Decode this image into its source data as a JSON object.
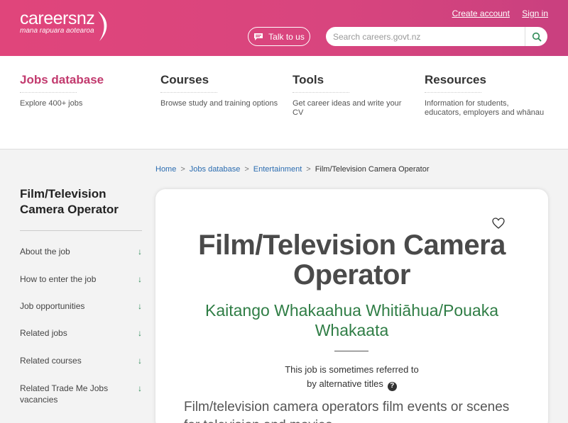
{
  "header": {
    "logo_main": "careersnz",
    "logo_sub": "mana rapuara aotearoa",
    "create_account": "Create account",
    "sign_in": "Sign in",
    "talk_label": "Talk to us",
    "search_placeholder": "Search careers.govt.nz",
    "brand_color": "#d8457e"
  },
  "nav": [
    {
      "title": "Jobs database",
      "desc": "Explore 400+ jobs"
    },
    {
      "title": "Courses",
      "desc": "Browse study and training options"
    },
    {
      "title": "Tools",
      "desc": "Get career ideas and write your CV"
    },
    {
      "title": "Resources",
      "desc": "Information for students, educators, employers and whānau"
    }
  ],
  "breadcrumb": {
    "home": "Home",
    "jobs": "Jobs database",
    "category": "Entertainment",
    "current": "Film/Television Camera Operator",
    "sep": ">"
  },
  "sidebar": {
    "title": "Film/Television Camera Operator",
    "items": [
      "About the job",
      "How to enter the job",
      "Job opportunities",
      "Related jobs",
      "Related courses",
      "Related Trade Me Jobs vacancies"
    ],
    "arrow": "↓"
  },
  "main": {
    "title": "Film/Television Camera Operator",
    "maori_title": "Kaitango Whakaahua Whitiāhua/Pouaka Whakaata",
    "alt_line1": "This job is sometimes referred to",
    "alt_line2": "by alternative titles",
    "summary": "Film/television camera operators film events or scenes for television and movies."
  }
}
